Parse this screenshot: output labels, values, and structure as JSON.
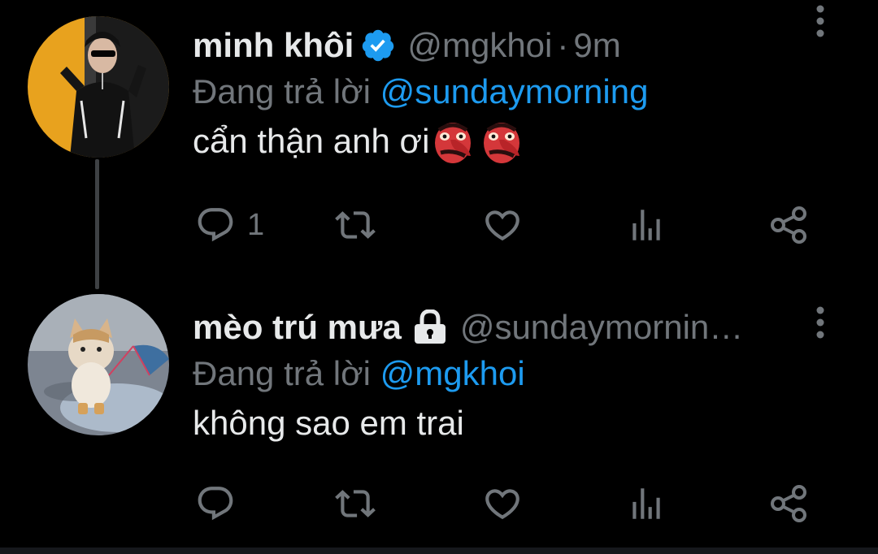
{
  "colors": {
    "background": "#000000",
    "primary_text": "#e7e9ea",
    "secondary_text": "#71767b",
    "link": "#1d9bf0",
    "verified_badge": "#1d9bf0"
  },
  "tweets": [
    {
      "display_name": "minh khôi",
      "verified": true,
      "handle": "@mgkhoi",
      "separator": "·",
      "time": "9m",
      "reply_label": "Đang trả lời",
      "reply_mention": "@sundaymorning",
      "text": "cẩn thận anh ơi",
      "emoji": [
        "tengu-mask-emoji",
        "tengu-mask-emoji"
      ],
      "reply_count": "1"
    },
    {
      "display_name": "mèo trú mưa",
      "protected": true,
      "handle": "@sundaymornin…",
      "reply_label": "Đang trả lời",
      "reply_mention": "@mgkhoi",
      "text": "không sao em trai",
      "reply_count": ""
    }
  ],
  "icons": {
    "more": "more-vertical-icon",
    "reply": "reply-icon",
    "retweet": "retweet-icon",
    "like": "heart-icon",
    "views": "views-icon",
    "share": "share-icon",
    "verified": "verified-badge-icon",
    "protected": "lock-icon"
  }
}
